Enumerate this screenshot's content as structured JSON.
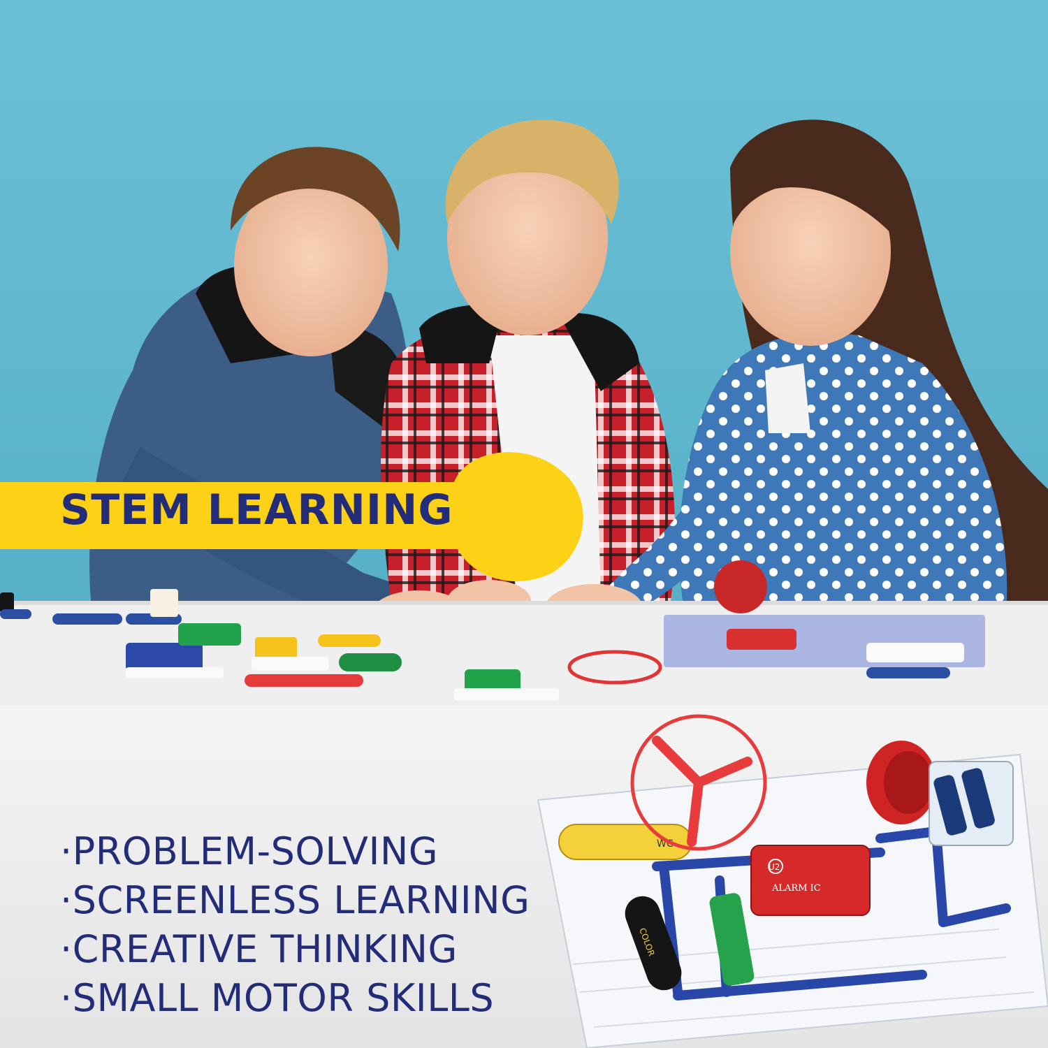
{
  "colors": {
    "background_blue": "#62b8cf",
    "table_white": "#efefef",
    "banner_yellow": "#fcd116",
    "text_navy": "#232c79",
    "panel_gray": "#ebebeb"
  },
  "heading": "STEM LEARNING",
  "bullets": [
    "·PROBLEM-SOLVING",
    "·SCREENLESS LEARNING",
    "·CREATIVE THINKING",
    "·SMALL MOTOR SKILLS"
  ],
  "kit_labels": {
    "motor_label": "WC",
    "alarm_label": "U2",
    "alarm_text": "ALARM IC",
    "color_label": "COLOR"
  }
}
